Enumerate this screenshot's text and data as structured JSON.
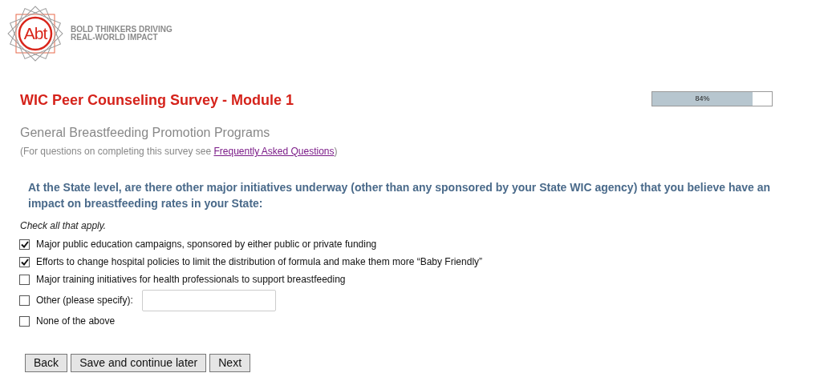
{
  "logo": {
    "mark": "Abt",
    "tagline": [
      "BOLD THINKERS DRIVING",
      "REAL-WORLD IMPACT"
    ]
  },
  "title": "WIC Peer Counseling Survey - Module 1",
  "progress": {
    "level": 0.84,
    "reading": "84%"
  },
  "section": "General Breastfeeding Promotion Programs",
  "help": {
    "before": "(For questions on completing this survey see ",
    "link": "Frequently Asked Questions",
    "after": ")"
  },
  "question": "At the State level, are there other major initiatives underway (other than any sponsored by your State WIC agency) that you believe have an impact on breastfeeding rates in your State:",
  "instruction": "Check all that apply.",
  "options": [
    {
      "kind": "checkbox",
      "label": "Major public education campaigns, sponsored by either public or private funding",
      "checked": true
    },
    {
      "kind": "checkbox",
      "label": "Efforts to change hospital policies to limit the distribution of formula and make them more “Baby Friendly”",
      "checked": true
    },
    {
      "kind": "checkbox",
      "label": "Major training initiatives for health professionals to support breastfeeding",
      "checked": false
    },
    {
      "kind": "specify",
      "label": "Other (please specify):",
      "checked": false
    },
    {
      "kind": "checkbox",
      "label": "None of the above",
      "checked": false
    }
  ],
  "buttons": [
    "Back",
    "Save and continue later",
    "Next"
  ]
}
